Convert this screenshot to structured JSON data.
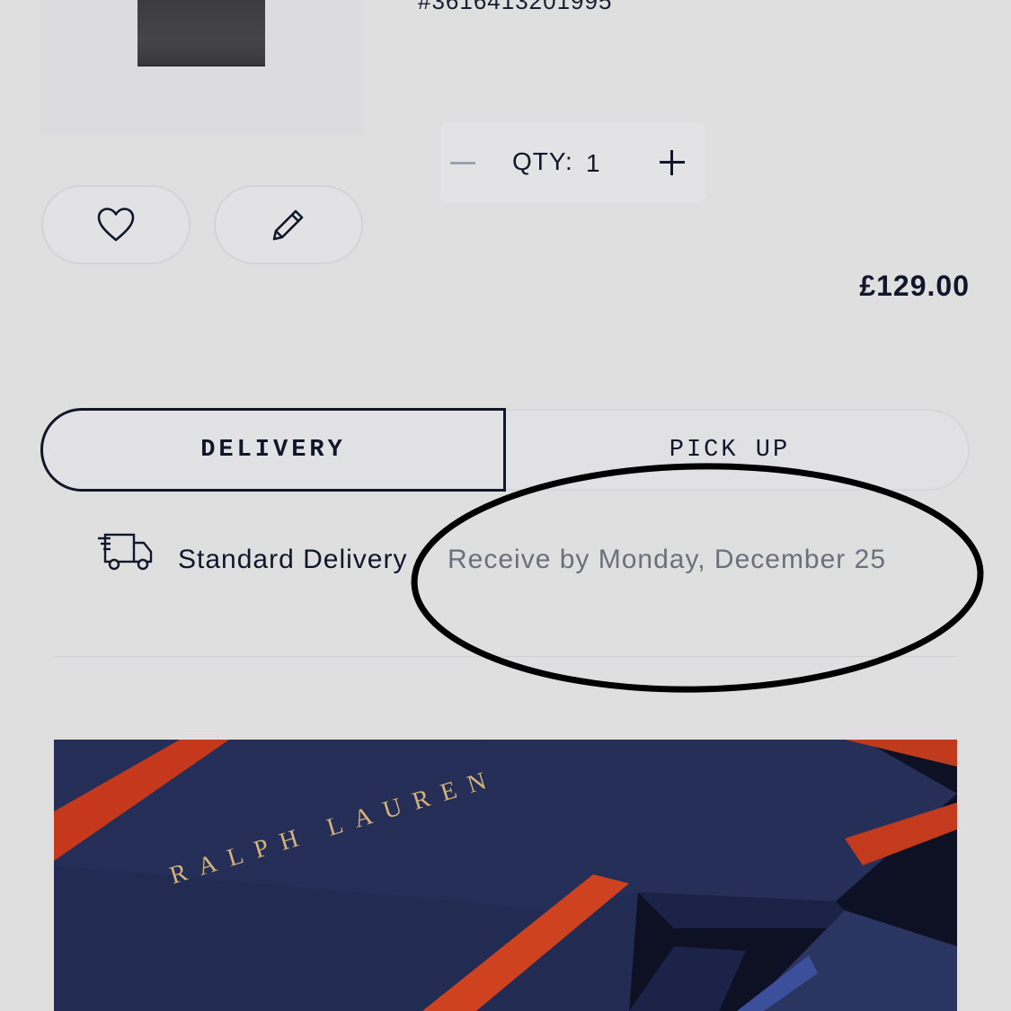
{
  "product": {
    "sku": "#3616413201995"
  },
  "quantity": {
    "label": "QTY:",
    "value": "1"
  },
  "price": "£129.00",
  "tabs": {
    "delivery": "DELIVERY",
    "pickup": "PICK UP",
    "selected": "DELIVERY"
  },
  "shipping": {
    "method": "Standard Delivery",
    "estimate": "Receive by Monday, December 25"
  },
  "promo": {
    "brand": "RALPH LAUREN"
  },
  "icons": {
    "wishlist": "heart-icon",
    "edit": "pencil-icon",
    "minus": "minus-icon",
    "plus": "plus-icon",
    "delivery": "truck-icon"
  },
  "colors": {
    "background": "#dfdfe0",
    "text": "#12162b",
    "muted": "#6c6f7c",
    "promo_navy": "#1c2750",
    "promo_red": "#c8391a",
    "brand_gold": "#d4b37b"
  }
}
